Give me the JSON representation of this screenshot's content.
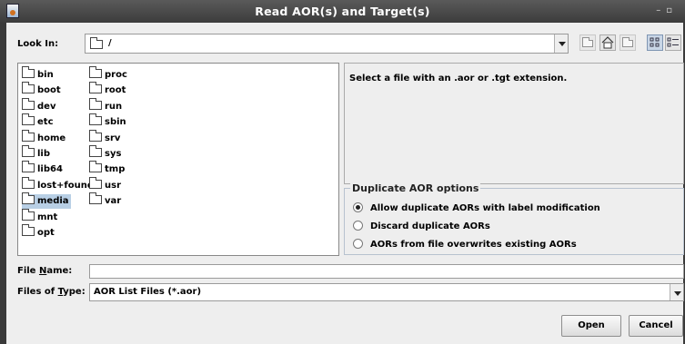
{
  "window": {
    "title": "Read AOR(s) and Target(s)"
  },
  "look_in": {
    "label": "Look In:",
    "value": "/"
  },
  "files": [
    {
      "name": "bin",
      "col": 0,
      "row": 0
    },
    {
      "name": "boot",
      "col": 0,
      "row": 1
    },
    {
      "name": "dev",
      "col": 0,
      "row": 2
    },
    {
      "name": "etc",
      "col": 0,
      "row": 3
    },
    {
      "name": "home",
      "col": 0,
      "row": 4
    },
    {
      "name": "lib",
      "col": 0,
      "row": 5
    },
    {
      "name": "lib64",
      "col": 0,
      "row": 6
    },
    {
      "name": "lost+found",
      "col": 0,
      "row": 7
    },
    {
      "name": "media",
      "col": 0,
      "row": 8,
      "selected": true
    },
    {
      "name": "mnt",
      "col": 0,
      "row": 9
    },
    {
      "name": "opt",
      "col": 0,
      "row": 10
    },
    {
      "name": "proc",
      "col": 1,
      "row": 0
    },
    {
      "name": "root",
      "col": 1,
      "row": 1
    },
    {
      "name": "run",
      "col": 1,
      "row": 2
    },
    {
      "name": "sbin",
      "col": 1,
      "row": 3
    },
    {
      "name": "srv",
      "col": 1,
      "row": 4
    },
    {
      "name": "sys",
      "col": 1,
      "row": 5
    },
    {
      "name": "tmp",
      "col": 1,
      "row": 6
    },
    {
      "name": "usr",
      "col": 1,
      "row": 7
    },
    {
      "name": "var",
      "col": 1,
      "row": 8
    }
  ],
  "info": {
    "message": "Select a file with an .aor or .tgt extension."
  },
  "duplicate_options": {
    "title": "Duplicate AOR options",
    "options": [
      {
        "label": "Allow duplicate AORs with label modification",
        "checked": true
      },
      {
        "label": "Discard duplicate AORs",
        "checked": false
      },
      {
        "label": "AORs from file overwrites existing AORs",
        "checked": false
      }
    ]
  },
  "file_name": {
    "label": "File Name:",
    "value": ""
  },
  "file_type": {
    "label": "Files of Type:",
    "value": "AOR List Files (*.aor)"
  },
  "buttons": {
    "open": "Open",
    "cancel": "Cancel"
  },
  "colors": {
    "selection": "#b8cfe5",
    "titlebar": "#3c3c3c"
  }
}
